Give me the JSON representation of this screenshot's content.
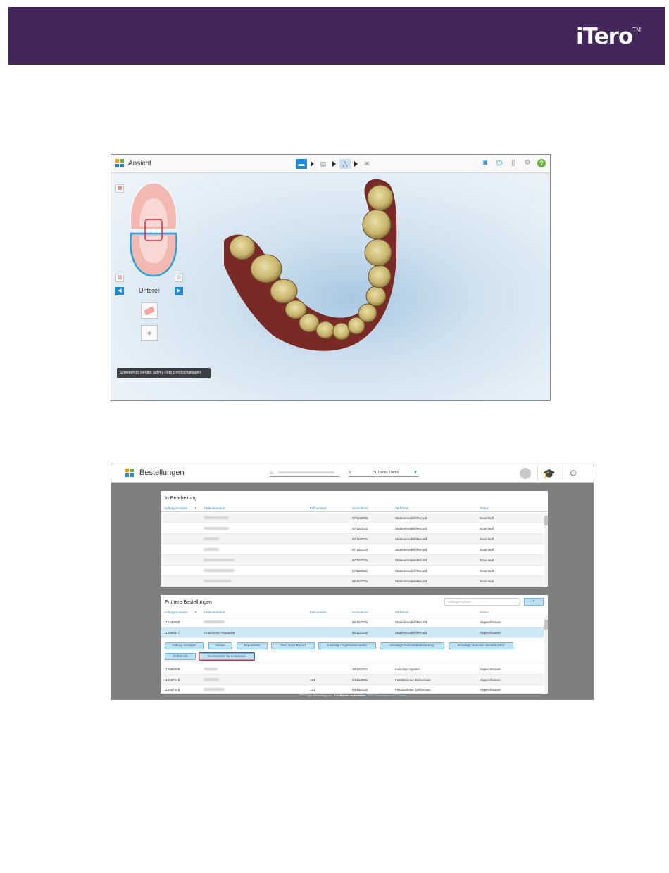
{
  "brand": {
    "logo_text": "iTero",
    "logo_tm": "TM",
    "colors": {
      "banner": "#43275a",
      "accent": "#1e88d1",
      "highlight": "#d12b3c",
      "help": "#6ab33e"
    }
  },
  "viewer": {
    "title": "Ansicht",
    "app_icon": "grid-icon",
    "steps": [
      "folder-icon",
      "clipboard-icon",
      "scan-icon",
      "mail-icon"
    ],
    "right_icons": [
      "camera-icon",
      "timer-icon",
      "battery-icon",
      "gear-icon",
      "help-icon"
    ],
    "help_glyph": "?",
    "arch_label": "Unterer",
    "toast": "Screenshots werden auf my iTero.com hochgeladen"
  },
  "orders": {
    "title": "Bestellungen",
    "doctor": "Dr. Demo, Demo",
    "in_progress": {
      "title": "In Bearbeitung",
      "columns": [
        "Auftragsnummer",
        "Patientenname",
        "Fallnummer",
        "Scandatum",
        "Verfahren",
        "Status"
      ],
      "rows": [
        {
          "order": "",
          "case": "",
          "date": "07/12/2022",
          "proc": "Studienmodell/iRecord",
          "status": "Scan läuft"
        },
        {
          "order": "",
          "case": "",
          "date": "07/12/2022",
          "proc": "Studienmodell/iRecord",
          "status": "Scan läuft"
        },
        {
          "order": "",
          "case": "",
          "date": "07/12/2022",
          "proc": "Studienmodell/iRecord",
          "status": "Scan läuft"
        },
        {
          "order": "",
          "case": "",
          "date": "07/12/2022",
          "proc": "Studienmodell/iRecord",
          "status": "Scan läuft"
        },
        {
          "order": "",
          "case": "",
          "date": "07/12/2022",
          "proc": "Studienmodell/iRecord",
          "status": "Scan läuft"
        },
        {
          "order": "",
          "case": "",
          "date": "07/12/2022",
          "proc": "Studienmodell/iRecord",
          "status": "Scan läuft"
        },
        {
          "order": "",
          "case": "",
          "date": "06/12/2022",
          "proc": "Studienmodell/iRecord",
          "status": "Scan läuft"
        }
      ]
    },
    "past": {
      "title": "Frühere Bestellungen",
      "search_placeholder": "Aufträge suchen",
      "columns": [
        "Auftragsnummer",
        "Patientenname",
        "Fallnummer",
        "Scandatum",
        "Verfahren",
        "Status"
      ],
      "rows_top": [
        {
          "order": "112100290",
          "name": "",
          "case": "",
          "date": "06/12/2022",
          "proc": "Studienmodell/iRecord",
          "status": "Abgeschlossen"
        },
        {
          "order": "113099417",
          "name": "Kharlchevs, Anastasia",
          "case": "",
          "date": "06/12/2022",
          "proc": "Studienmodell/iRecord",
          "status": "Abgeschlossen"
        }
      ],
      "actions": [
        "Auftrag anzeigen",
        "Viewer",
        "Exportieren",
        "iTero Scan Report",
        "Invisalign Ergebnissimulator",
        "Invisalign Fortschrittsbewertung",
        "Invisalign Outcome Simulator Pro",
        "OrthoCAD",
        "Screenshots herunterladen"
      ],
      "rows_bottom": [
        {
          "order": "113096009",
          "name": "",
          "case": "",
          "date": "06/12/2022",
          "proc": "Invisalign System",
          "status": "Abgeschlossen"
        },
        {
          "order": "112967946",
          "name": "",
          "case": "123",
          "date": "04/12/2022",
          "proc": "Festsitzender Zahnersatz",
          "status": "Abgeschlossen"
        },
        {
          "order": "112967946",
          "name": "",
          "case": "123",
          "date": "04/12/2022",
          "proc": "Festsitzender Zahnersatz",
          "status": "Abgeschlossen"
        }
      ]
    },
    "footer": {
      "copyright": "2022 Align Technology, Inc.",
      "rights": "Alle Rechte vorbehalten.",
      "links": "AGB Datenschutz und Cookies"
    }
  }
}
